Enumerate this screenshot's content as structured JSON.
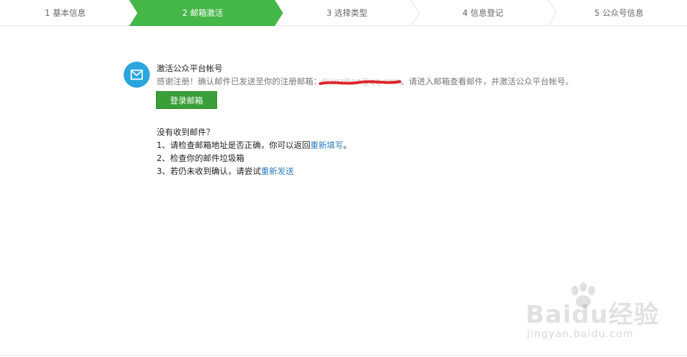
{
  "steps": [
    {
      "label": "1 基本信息",
      "active": false
    },
    {
      "label": "2 邮箱激活",
      "active": true
    },
    {
      "label": "3 选择类型",
      "active": false
    },
    {
      "label": "4 信息登记",
      "active": false
    },
    {
      "label": "5 公众号信息",
      "active": false
    }
  ],
  "colors": {
    "active_step": "#45b648",
    "button": "#3a9e39",
    "icon_bg": "#2aa5df",
    "link": "#2e7bbf",
    "redaction": "#e0242b"
  },
  "activation": {
    "icon": "mail-icon",
    "title": "激活公众平台帐号",
    "desc_prefix": "感谢注册！确认邮件已发送至你的注册邮箱：",
    "email_redacted": "dianziban@qq.com",
    "desc_suffix": "。请进入邮箱查看邮件，并激活公众平台帐号。",
    "login_button": "登录邮箱"
  },
  "help": {
    "question": "没有收到邮件？",
    "item1_prefix": "1、请检查邮箱地址是否正确，你可以返回",
    "item1_link": "重新填写",
    "item1_suffix": "。",
    "item2": "2、检查你的邮件垃圾箱",
    "item3_prefix": "3、若仍未收到确认，请尝试",
    "item3_link": "重新发送"
  },
  "watermark": {
    "brand": "Baidu经验",
    "site": "jingyan.baidu.com"
  }
}
